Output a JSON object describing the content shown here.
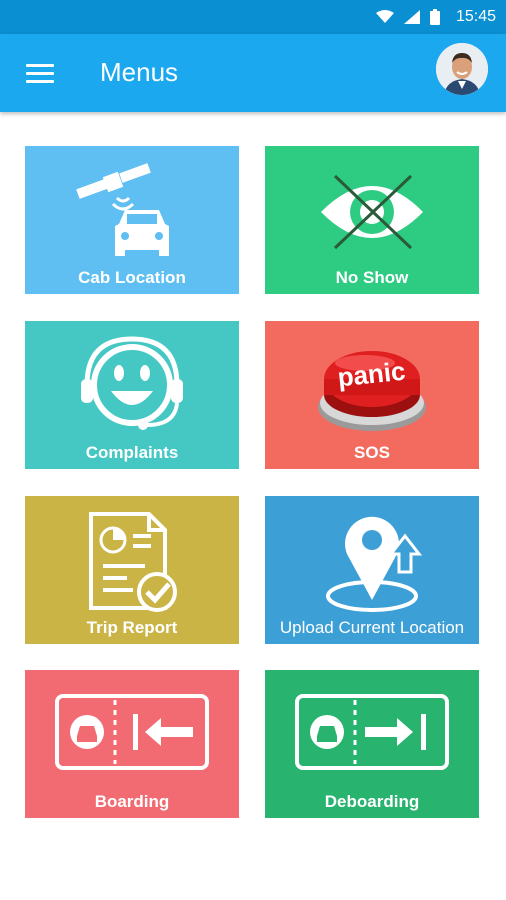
{
  "status_bar": {
    "time": "15:45"
  },
  "app_bar": {
    "title": "Menus"
  },
  "tiles": [
    {
      "label": "Cab Location",
      "color": "#5fbef2",
      "icon": "satellite-car-icon"
    },
    {
      "label": "No Show",
      "color": "#2ecc82",
      "icon": "crossed-eye-icon"
    },
    {
      "label": "Complaints",
      "color": "#45c8c4",
      "icon": "headset-smiley-icon"
    },
    {
      "label": "SOS",
      "color": "#f26b5e",
      "icon": "panic-button-icon",
      "icon_text": "panic"
    },
    {
      "label": "Trip Report",
      "color": "#c9b445",
      "icon": "report-document-icon"
    },
    {
      "label": "Upload Current Location",
      "color": "#3c9fd6",
      "icon": "location-upload-icon"
    },
    {
      "label": "Boarding",
      "color": "#f26b73",
      "icon": "boarding-ticket-icon"
    },
    {
      "label": "Deboarding",
      "color": "#28b36f",
      "icon": "deboarding-ticket-icon"
    }
  ]
}
